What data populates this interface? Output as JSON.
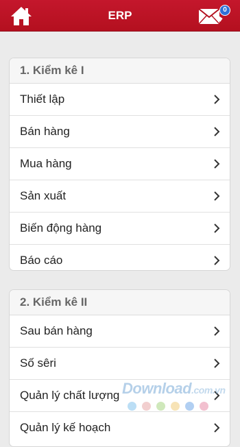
{
  "header": {
    "title": "ERP",
    "unread_count": "0",
    "brand_color": "#c4172c"
  },
  "sections": [
    {
      "title": "1. Kiểm kê I",
      "items": [
        "Thiết lập",
        "Bán hàng",
        "Mua hàng",
        "Sản xuất",
        "Biến động hàng",
        "Báo cáo"
      ]
    },
    {
      "title": "2. Kiểm kê II",
      "items": [
        "Sau bán hàng",
        "Số sêri",
        "Quản lý chất lượng",
        "Quản lý kế hoạch"
      ]
    }
  ],
  "watermark": {
    "text": "Download",
    "suffix": ".com.vn"
  },
  "icons": {
    "home": "home-icon",
    "mail": "mail-icon",
    "chevron": "chevron-right-icon"
  }
}
